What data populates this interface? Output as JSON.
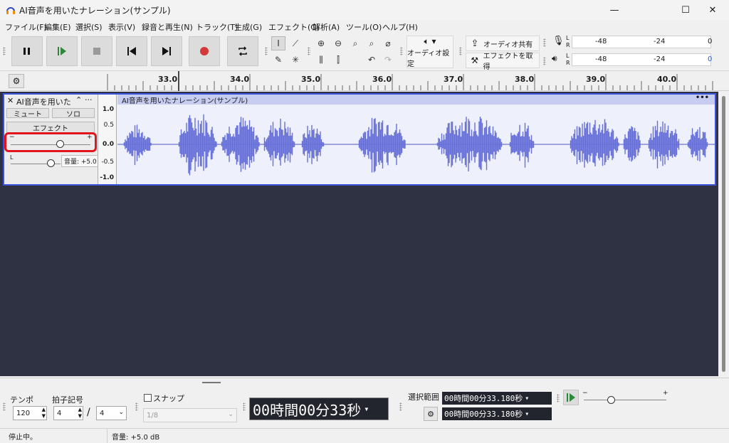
{
  "window": {
    "title": "AI音声を用いたナレーション(サンプル)",
    "minimize": "—",
    "maximize": "☐",
    "close": "✕"
  },
  "menu": [
    "ファイル(F)",
    "編集(E)",
    "選択(S)",
    "表示(V)",
    "録音と再生(N)",
    "トラック(T)",
    "生成(G)",
    "エフェクト(C)",
    "解析(A)",
    "ツール(O)",
    "ヘルプ(H)"
  ],
  "toolbar": {
    "audio_settings": "オーディオ設定",
    "share_audio": "オーディオ共有",
    "get_effects": "エフェクトを取得",
    "meter_rec_ticks": [
      "-48",
      "-24",
      "0"
    ],
    "meter_play_ticks": [
      "-48",
      "-24",
      "0"
    ],
    "meter_rec_labels": [
      "L",
      "R"
    ],
    "meter_play_labels": [
      "L",
      "R"
    ]
  },
  "ruler": {
    "ticks": [
      "33.0",
      "34.0",
      "35.0",
      "36.0",
      "37.0",
      "38.0",
      "39.0",
      "40.0"
    ]
  },
  "track": {
    "name": "AI音声を用いた",
    "mute": "ミュート",
    "solo": "ソロ",
    "effects": "エフェクト",
    "gain_minus": "−",
    "gain_plus": "+",
    "pan_left": "L",
    "pan_right": "R",
    "tooltip": "音量: +5.0 dB",
    "gain_level": 0.62,
    "pan_level": 0.5,
    "menu": "···"
  },
  "clip": {
    "title": "AI音声を用いたナレーション(サンプル)",
    "menu": "•••"
  },
  "amp_scale": [
    "1.0",
    "0.5",
    "0.0",
    "-0.5",
    "-1.0"
  ],
  "bottom": {
    "tempo_label": "テンポ",
    "tempo": "120",
    "time_sig_label": "拍子記号",
    "time_sig_num": "4",
    "time_sig_sep": "/",
    "time_sig_den": "4",
    "snap_label": "スナップ",
    "snap_value": "1/8",
    "time_display": "00時間00分33秒",
    "selection_label": "選択範囲",
    "sel_start": "00時間00分33.180秒",
    "sel_end": "00時間00分33.180秒",
    "speed_minus": "−",
    "speed_plus": "+",
    "speed_level": 0.33
  },
  "status": {
    "left": "停止中。",
    "right": "音量: +5.0 dB"
  },
  "colors": {
    "accent": "#3c54d8",
    "waveform": "#6670d8",
    "record": "#d23a3a",
    "highlight": "#e4141e"
  }
}
